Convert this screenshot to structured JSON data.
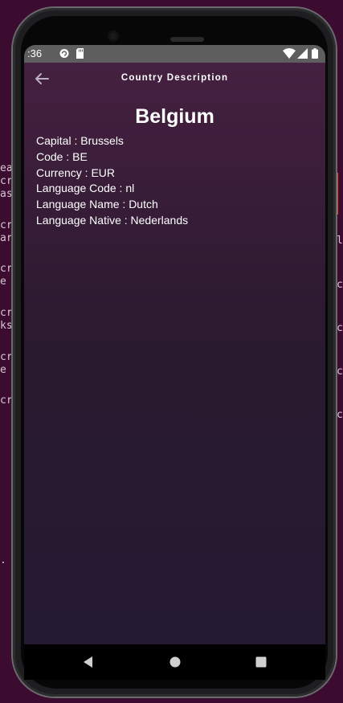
{
  "status_bar": {
    "time": ":36",
    "icons": [
      "sync-icon",
      "sd-card-icon",
      "wifi-icon",
      "signal-icon",
      "battery-icon"
    ]
  },
  "app_bar": {
    "title": "Country Description",
    "back_icon": "arrow-left-icon"
  },
  "country": {
    "name": "Belgium",
    "details": [
      "Capital : Brussels",
      "Code : BE",
      "Currency : EUR",
      "Language Code : nl",
      "Language Name : Dutch",
      "Language Native : Nederlands"
    ]
  },
  "nav_bar": {
    "icons": [
      "back-triangle-icon",
      "home-circle-icon",
      "recents-square-icon"
    ]
  },
  "background_terminal": {
    "left_lines": [
      "ea",
      "cr",
      "as",
      "",
      "",
      "cr",
      "ar",
      "",
      "",
      "cr",
      "e",
      "",
      "",
      "cr",
      "ks",
      "",
      "",
      "cr",
      "e",
      "",
      "",
      "cr",
      "  a"
    ],
    "right_lines": [
      "l",
      "c",
      "c",
      "c",
      "c"
    ]
  },
  "colors": {
    "desktop_bg": "#3b0b30",
    "app_gradient_top": "#452040",
    "app_gradient_bottom": "#241a32",
    "status_bar": "#5e5e5e",
    "text": "#ffffff"
  }
}
